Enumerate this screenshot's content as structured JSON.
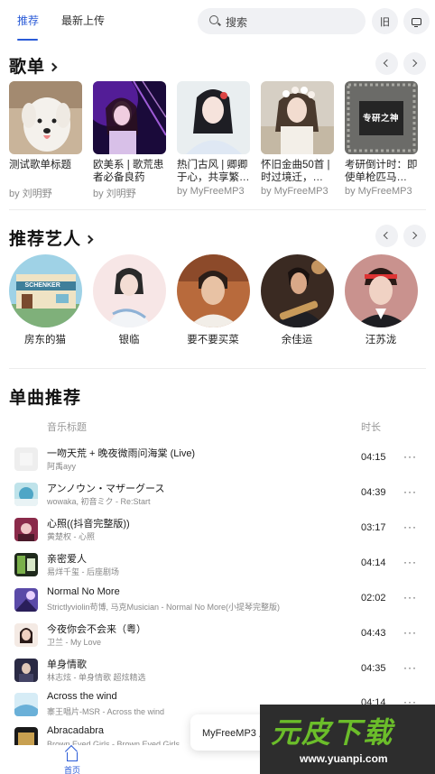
{
  "header": {
    "tabs": [
      {
        "label": "推荐",
        "active": true
      },
      {
        "label": "最新上传",
        "active": false
      }
    ],
    "search_placeholder": "搜索",
    "old_button": "旧",
    "accent_color": "#2a5bd7"
  },
  "playlists": {
    "title": "歌单",
    "items": [
      {
        "title": "测试歌单标题",
        "author": "by 刘明野"
      },
      {
        "title": "欧美系 | 歌荒患者必备良药",
        "author": "by 刘明野"
      },
      {
        "title": "热门古风 | 卿卿于心，共享繁…",
        "author": "by MyFreeMP3"
      },
      {
        "title": "怀旧金曲50首 | 时过境迁，…",
        "author": "by MyFreeMP3"
      },
      {
        "title": "考研倒计时：即使单枪匹马…",
        "author": "by MyFreeMP3"
      }
    ],
    "cover5_text": "专研之神"
  },
  "artists": {
    "title": "推荐艺人",
    "items": [
      {
        "name": "房东的猫"
      },
      {
        "name": "银临"
      },
      {
        "name": "要不要买菜"
      },
      {
        "name": "余佳运"
      },
      {
        "name": "汪苏泷"
      }
    ],
    "avatar1_text": "SCHENKER"
  },
  "songs": {
    "title": "单曲推荐",
    "col_title": "音乐标题",
    "col_duration": "时长",
    "more_glyph": "···",
    "items": [
      {
        "name": "一吻天荒 + 晚夜微雨问海棠 (Live)",
        "sub": "阿禹ayy",
        "duration": "04:15"
      },
      {
        "name": "アンノウン・マザーグース",
        "sub": "wowaka, 初音ミク - Re:Start",
        "duration": "04:39"
      },
      {
        "name": "心照((抖音完整版))",
        "sub": "黄楚权 - 心照",
        "duration": "03:17"
      },
      {
        "name": "亲密爱人",
        "sub": "易烊千玺 - 后座剧场",
        "duration": "04:14"
      },
      {
        "name": "Normal No More",
        "sub": "Strictlyviolin苟博, 马克Musician - Normal No More(小提琴完整版)",
        "duration": "02:02"
      },
      {
        "name": "今夜你会不会来（粤）",
        "sub": "卫兰 - My Love",
        "duration": "04:43"
      },
      {
        "name": "单身情歌",
        "sub": "林志炫 - 单身情歌 超炫精选",
        "duration": "04:35"
      },
      {
        "name": "Across the wind",
        "sub": "寨王唱片-MSR - Across the wind",
        "duration": "04:14"
      },
      {
        "name": "Abracadabra",
        "sub": "Brown Eyed Girls - Brown Eyed Girls",
        "duration": ""
      }
    ]
  },
  "bottom_nav": {
    "home_label": "首页"
  },
  "toast": {
    "text": "MyFreeMP3 应用已启动 使用"
  },
  "watermark": {
    "main": "元皮下载",
    "url": "www.yuanpi.com"
  }
}
